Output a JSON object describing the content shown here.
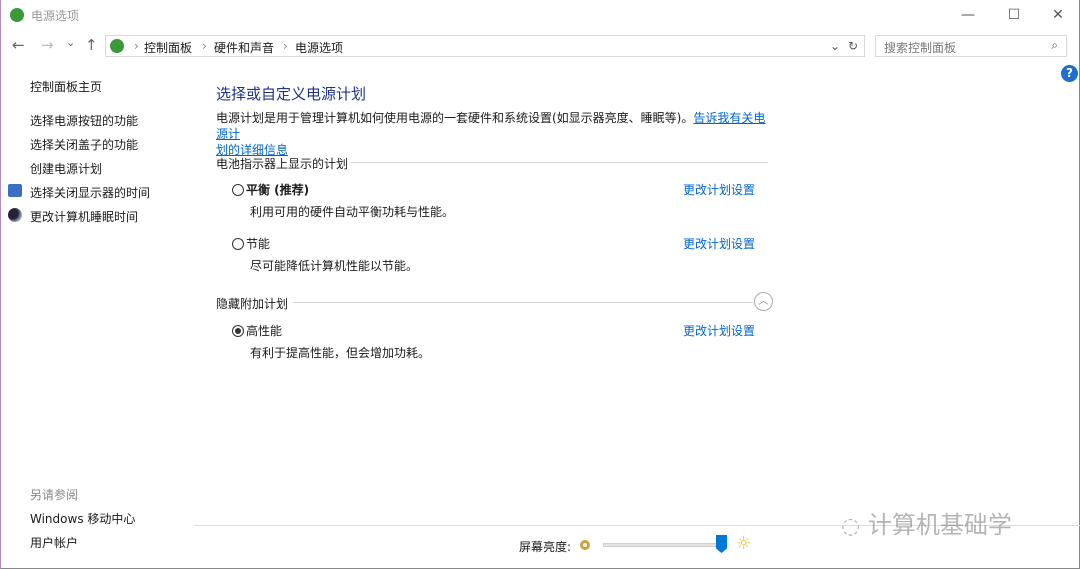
{
  "window": {
    "title": "电源选项",
    "minimize": "—",
    "maximize": "☐",
    "close": "✕"
  },
  "toolbar": {
    "back": "←",
    "forward": "→",
    "recent": "⌄",
    "up": "↑",
    "refresh": "↻",
    "dropdown": "⌄",
    "breadcrumb": [
      "控制面板",
      "硬件和声音",
      "电源选项"
    ],
    "search_placeholder": "搜索控制面板",
    "help": "?"
  },
  "sidebar": {
    "home": "控制面板主页",
    "items": [
      "选择电源按钮的功能",
      "选择关闭盖子的功能",
      "创建电源计划",
      "选择关闭显示器的时间",
      "更改计算机睡眠时间"
    ],
    "see_also": "另请参阅",
    "see_also_items": [
      "Windows 移动中心",
      "用户帐户"
    ]
  },
  "main": {
    "title": "选择或自定义电源计划",
    "intro": "电源计划是用于管理计算机如何使用电源的一套硬件和系统设置(如显示器亮度、睡眠等)。",
    "intro_link_1": "告诉我有关电源计",
    "intro_link_2": "划的详细信息",
    "battery_section": "电池指示器上显示的计划",
    "hidden_section": "隐藏附加计划",
    "plans": [
      {
        "name": "平衡 (推荐)",
        "desc": "利用可用的硬件自动平衡功耗与性能。",
        "change": "更改计划设置",
        "selected": false
      },
      {
        "name": "节能",
        "desc": "尽可能降低计算机性能以节能。",
        "change": "更改计划设置",
        "selected": false
      },
      {
        "name": "高性能",
        "desc": "有利于提高性能，但会增加功耗。",
        "change": "更改计划设置",
        "selected": true
      }
    ]
  },
  "footer": {
    "brightness_label": "屏幕亮度:",
    "brightness_percent": 100
  },
  "watermark": "计算机基础学",
  "colors": {
    "accent": "#0066cc",
    "title": "#1e3287",
    "slider_thumb": "#0078d7"
  }
}
